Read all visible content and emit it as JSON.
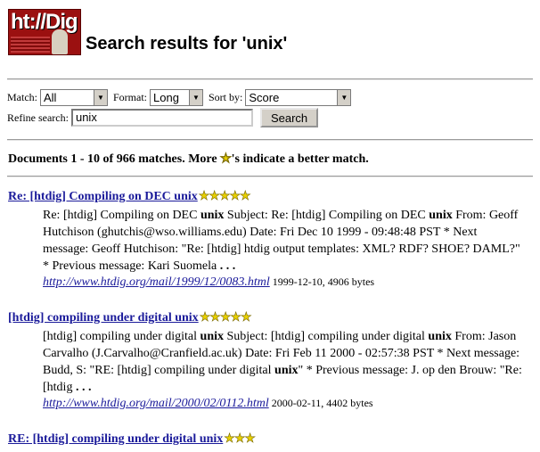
{
  "header": {
    "logo_text": "ht://Dig",
    "title": "Search results for 'unix'"
  },
  "form": {
    "match_label": "Match:",
    "match_value": "All",
    "format_label": "Format:",
    "format_value": "Long",
    "sortby_label": "Sort by:",
    "sortby_value": "Score",
    "refine_label": "Refine search:",
    "refine_value": "unix",
    "search_button": "Search"
  },
  "summary": {
    "text_before": "Documents 1 - 10 of 966 matches. More ",
    "text_after": "'s indicate a better match."
  },
  "results": [
    {
      "title": "Re: [htdig] Compiling on DEC unix",
      "stars": 5,
      "excerpt_parts": [
        "Re: [htdig] Compiling on DEC ",
        "unix",
        " Subject: Re: [htdig] Compiling on DEC ",
        "unix",
        " From: Geoff Hutchison (ghutchis@wso.williams.edu) Date: Fri Dec 10 1999 - 09:48:48 PST * Next message: Geoff Hutchison: \"Re: [htdig] htdig output templates: XML? RDF? SHOE? DAML?\" * Previous message: Kari Suomela"
      ],
      "ellipsis": " . . .",
      "url": "http://www.htdig.org/mail/1999/12/0083.html",
      "meta": "1999-12-10, 4906 bytes"
    },
    {
      "title": "[htdig] compiling under digital unix",
      "stars": 5,
      "excerpt_parts": [
        "[htdig] compiling under digital ",
        "unix",
        " Subject: [htdig] compiling under digital ",
        "unix",
        " From: Jason Carvalho (J.Carvalho@Cranfield.ac.uk) Date: Fri Feb 11 2000 - 02:57:38 PST * Next message: Budd, S: \"RE: [htdig] compiling under digital ",
        "unix",
        "\" * Previous message: J. op den Brouw: \"Re: [htdig"
      ],
      "ellipsis": " . . .",
      "url": "http://www.htdig.org/mail/2000/02/0112.html",
      "meta": "2000-02-11, 4402 bytes"
    },
    {
      "title": "RE: [htdig] compiling under digital unix",
      "stars": 3
    }
  ],
  "colors": {
    "link": "#1a1a9a",
    "star": "#e8d000",
    "logo_bg": "#9b1010"
  },
  "icons": {
    "star": "star-icon",
    "dropdown": "chevron-down-icon"
  }
}
